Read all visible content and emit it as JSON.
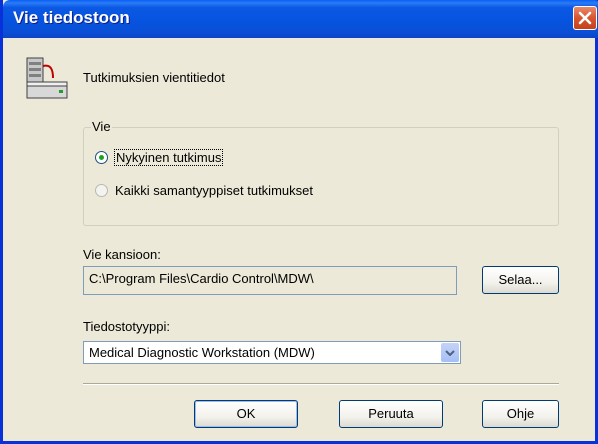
{
  "window": {
    "title": "Vie tiedostoon"
  },
  "header": {
    "icon": "server-icon",
    "text": "Tutkimuksien vientitiedot"
  },
  "export_group": {
    "legend": "Vie",
    "options": [
      {
        "label": "Nykyinen tutkimus",
        "checked": true
      },
      {
        "label": "Kaikki samantyyppiset tutkimukset",
        "checked": false
      }
    ]
  },
  "folder": {
    "label": "Vie kansioon:",
    "value": "C:\\Program Files\\Cardio Control\\MDW\\",
    "browse_label": "Selaa..."
  },
  "filetype": {
    "label": "Tiedostotyyppi:",
    "selected": "Medical Diagnostic Workstation (MDW)"
  },
  "buttons": {
    "ok": "OK",
    "cancel": "Peruuta",
    "help": "Ohje"
  },
  "colors": {
    "titlebar": "#0a54e0",
    "close": "#d9542e",
    "dialog_bg": "#ece9d8"
  }
}
